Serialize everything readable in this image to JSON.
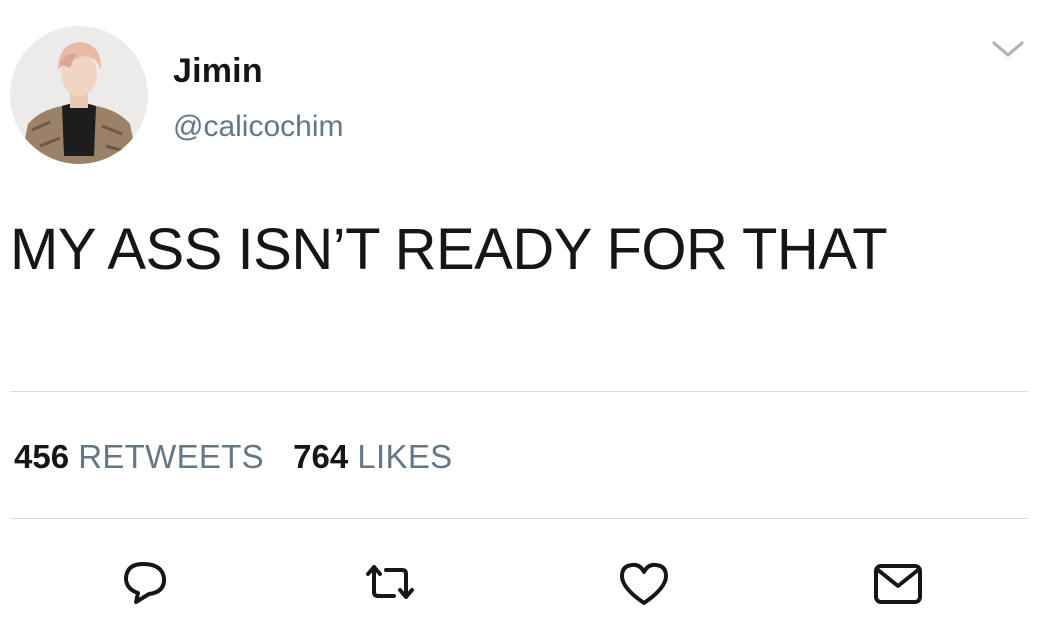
{
  "tweet": {
    "user": {
      "display_name": "Jimin",
      "handle": "@calicochim"
    },
    "text": "MY ASS ISN’T READY FOR THAT",
    "stats": {
      "retweets_count": "456",
      "retweets_label": "RETWEETS",
      "likes_count": "764",
      "likes_label": "LIKES"
    }
  },
  "icons": {
    "menu": "chevron-down-icon",
    "reply": "reply-icon",
    "retweet": "retweet-icon",
    "like": "heart-icon",
    "message": "envelope-icon"
  },
  "colors": {
    "text": "#14171a",
    "secondary": "#657786",
    "divider": "#d6dbe0",
    "icon": "#14171a"
  }
}
